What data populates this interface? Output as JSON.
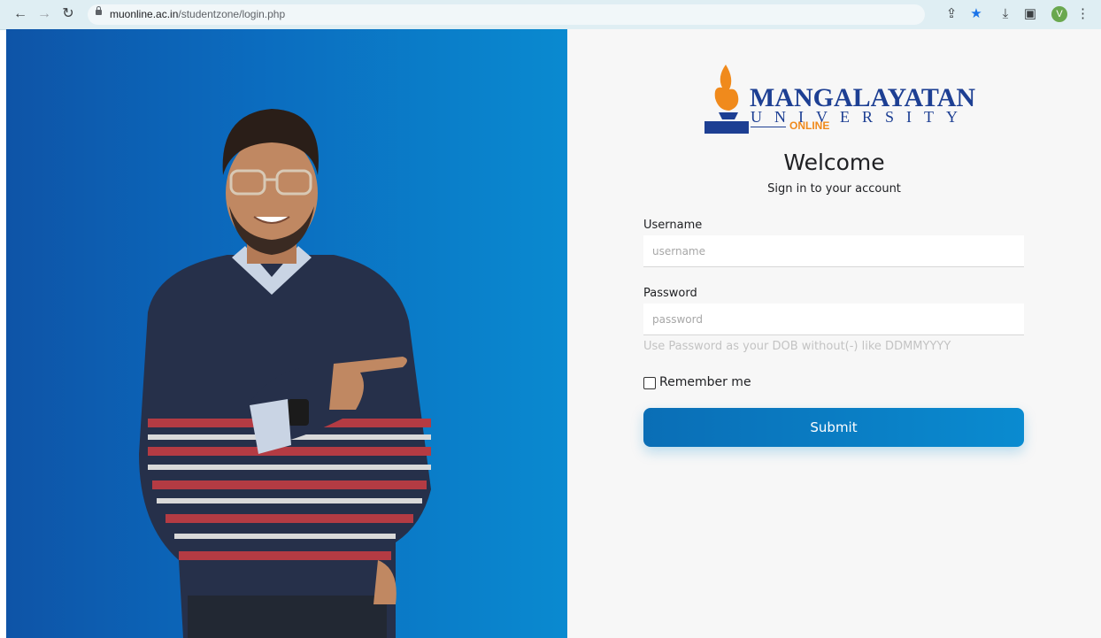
{
  "browser": {
    "url_host": "muonline.ac.in",
    "url_path": "/studentzone/login.php",
    "profile_initial": "V"
  },
  "logo": {
    "main": "MANGALAYATAN",
    "sub": "UNIVERSITY",
    "tag": "ONLINE"
  },
  "login": {
    "welcome": "Welcome",
    "subtitle": "Sign in to your account",
    "username_label": "Username",
    "username_placeholder": "username",
    "password_label": "Password",
    "password_placeholder": "password",
    "password_hint": "Use Password as your DOB without(-) like DDMMYYYY",
    "remember_label": "Remember me",
    "submit_label": "Submit"
  },
  "colors": {
    "accent": "#0a8bd0",
    "brand_blue": "#1d3f93",
    "brand_orange": "#f08a1c"
  }
}
